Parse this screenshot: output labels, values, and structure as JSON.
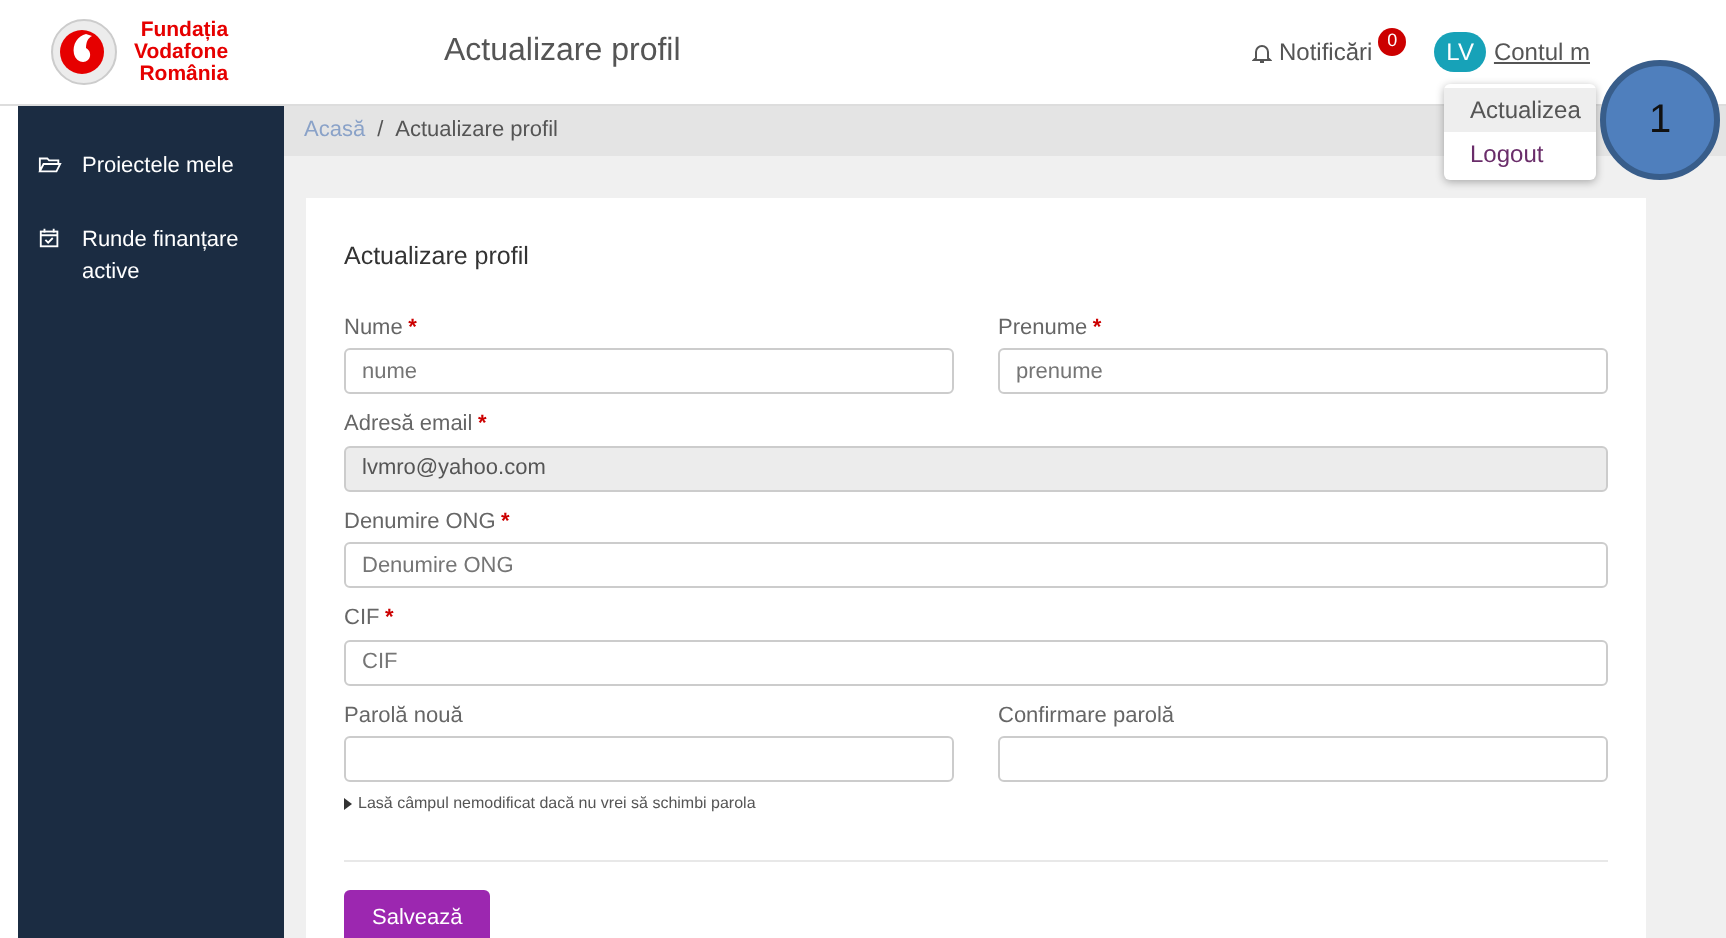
{
  "header": {
    "logo_lines": [
      "Fundația",
      "Vodafone",
      "România"
    ],
    "title": "Actualizare profil",
    "notifications": {
      "label": "Notificări",
      "count": "0"
    },
    "account": {
      "initials": "LV",
      "label": "Contul m"
    }
  },
  "account_menu": [
    {
      "label": "Actualizea",
      "selected": true
    },
    {
      "label": "Logout",
      "selected": false
    }
  ],
  "callout": "1",
  "sidebar": {
    "items": [
      {
        "label": "Proiectele mele"
      },
      {
        "label": "Runde finanțare active"
      }
    ]
  },
  "breadcrumb": [
    {
      "label": "Acasă",
      "kind": "link"
    },
    {
      "label": "/",
      "kind": "separator"
    },
    {
      "label": "Actualizare profil",
      "kind": "current"
    }
  ],
  "form": {
    "title": "Actualizare profil",
    "required_mark": "*",
    "rows": [
      [
        {
          "label": "Nume",
          "required": true,
          "placeholder": "nume",
          "disabled": false
        },
        {
          "label": "Prenume",
          "required": true,
          "placeholder": "prenume",
          "disabled": false
        }
      ],
      [
        {
          "label": "Adresă email",
          "required": true,
          "value": "lvmro@yahoo.com",
          "disabled": true
        }
      ],
      [
        {
          "label": "Denumire ONG",
          "required": true,
          "placeholder": "Denumire ONG",
          "disabled": false
        }
      ],
      [
        {
          "label": "CIF",
          "required": true,
          "placeholder": "CIF",
          "disabled": false
        }
      ],
      [
        {
          "label": "Parolă nouă",
          "required": false,
          "disabled": false,
          "hint": "Lasă câmpul nemodificat dacă nu vrei să schimbi parola"
        },
        {
          "label": "Confirmare parolă",
          "required": false,
          "disabled": false
        }
      ]
    ],
    "submit": "Salvează"
  }
}
